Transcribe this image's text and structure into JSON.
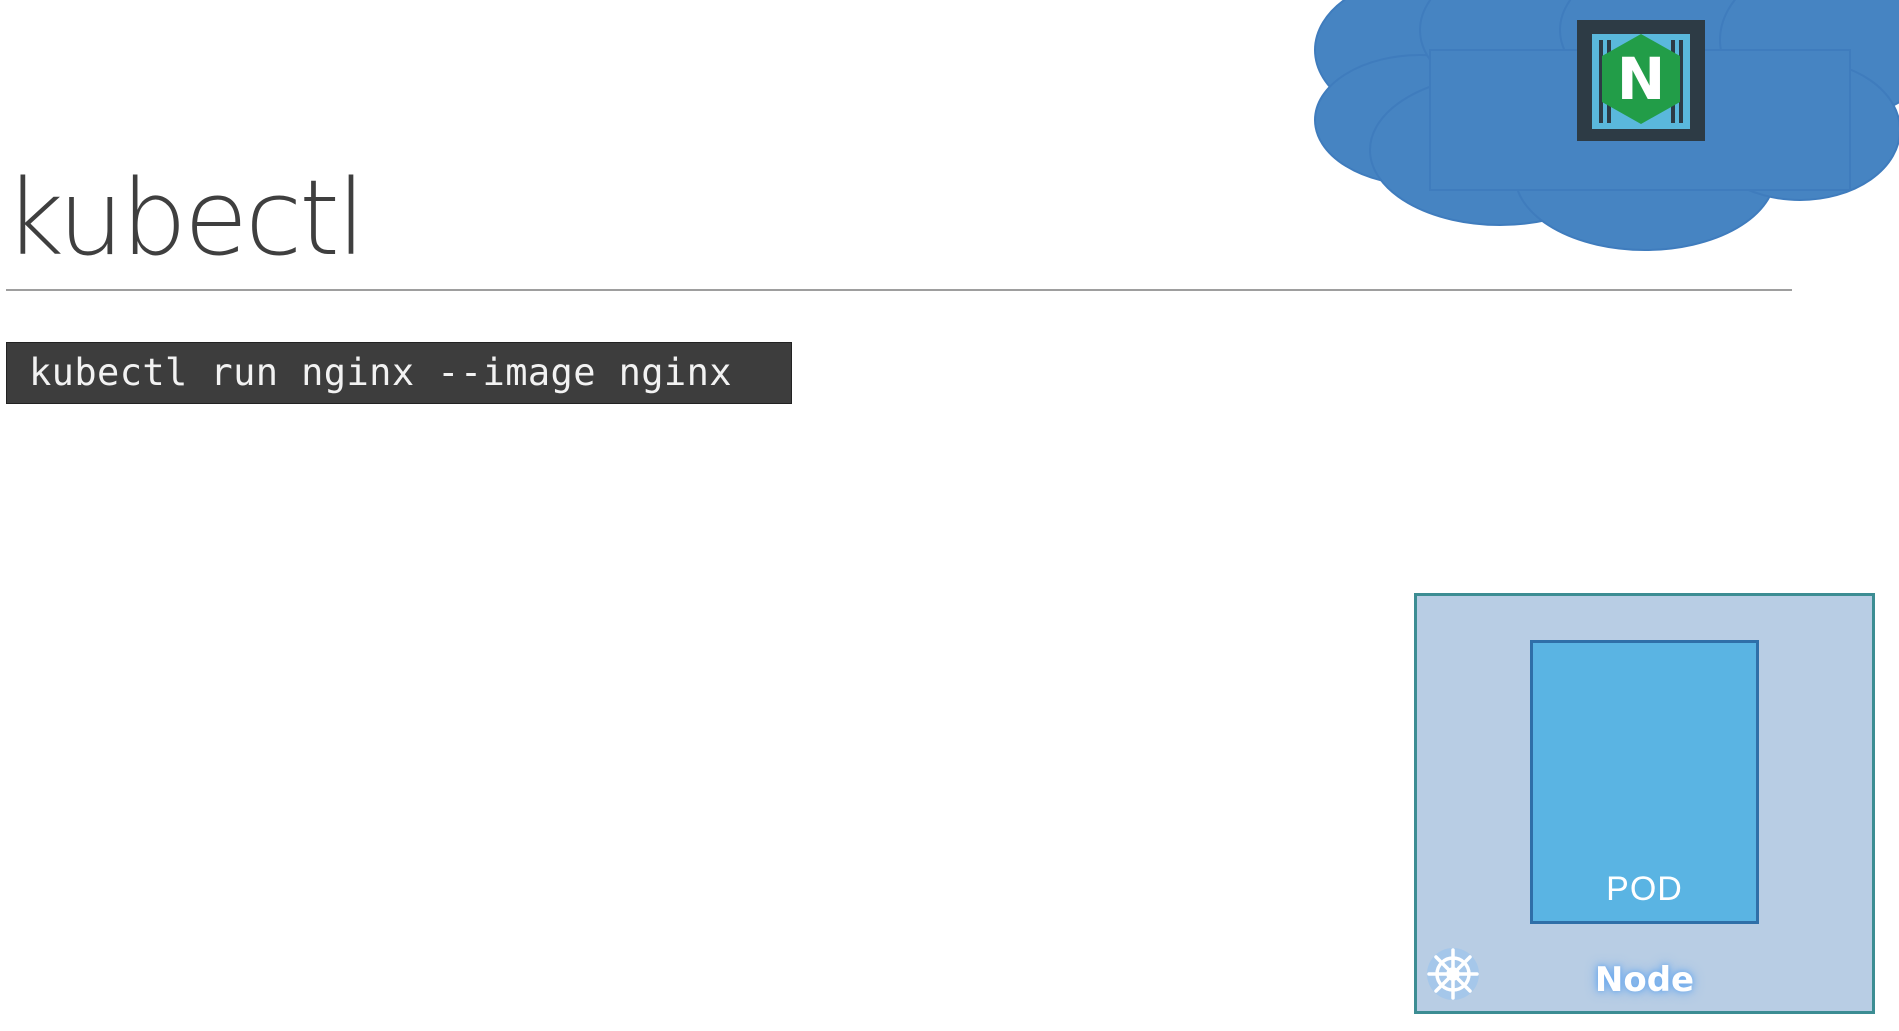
{
  "slide": {
    "title": "kubectl",
    "command": "kubectl run nginx --image nginx"
  },
  "cloud": {
    "icon": "cloud-icon",
    "badge": {
      "icon": "nginx-icon",
      "letter": "N"
    }
  },
  "node": {
    "label": "Node",
    "icon": "kubernetes-helm-icon",
    "pod": {
      "label": "POD"
    }
  },
  "colors": {
    "title": "#3f3f3f",
    "command_bg": "#3d3d3d",
    "command_text": "#f2f2f2",
    "cloud": "#4684c2",
    "node_fill": "#b8cde4",
    "node_border": "#3c8d93",
    "pod_fill": "#5ab4e3",
    "nginx_green": "#229d48"
  }
}
